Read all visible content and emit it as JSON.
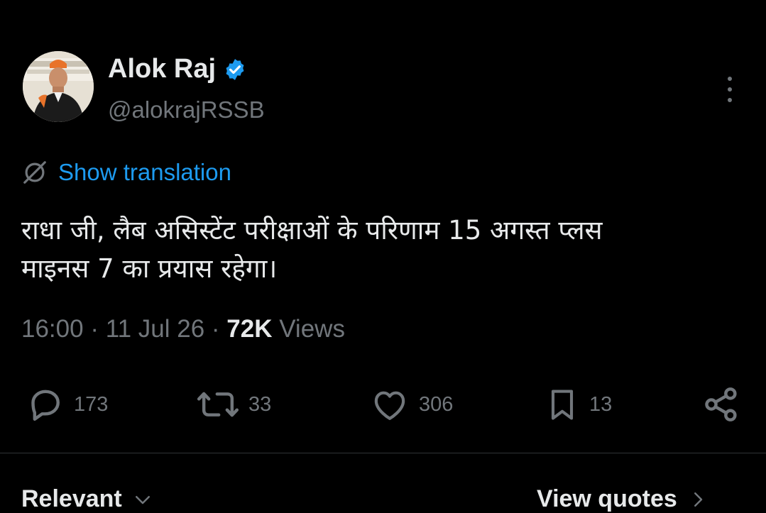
{
  "author": {
    "name": "Alok Raj",
    "handle": "@alokrajRSSB",
    "verified": true,
    "verified_color": "#1d9bf0"
  },
  "translate": {
    "label": "Show translation",
    "icon": "globe-slash-icon"
  },
  "tweet": {
    "line1": "राधा जी, लैब असिस्टेंट परीक्षाओं के परिणाम 15 अगस्त प्लस",
    "line2": "माइनस 7 का प्रयास रहेगा।"
  },
  "meta": {
    "time": "16:00",
    "separator1": " · ",
    "date": "11 Jul 26",
    "separator2": " · ",
    "views_count": "72K",
    "views_label": " Views"
  },
  "actions": {
    "reply": {
      "icon": "reply-icon",
      "count": "173"
    },
    "retweet": {
      "icon": "retweet-icon",
      "count": "33"
    },
    "like": {
      "icon": "heart-icon",
      "count": "306"
    },
    "bookmark": {
      "icon": "bookmark-icon",
      "count": "13"
    },
    "share": {
      "icon": "share-icon"
    }
  },
  "footer": {
    "sort_label": "Relevant",
    "quotes_label": "View quotes"
  },
  "colors": {
    "background": "#000000",
    "text": "#e7e9ea",
    "muted": "#71767b",
    "accent": "#1d9bf0",
    "divider": "#2f3336"
  }
}
